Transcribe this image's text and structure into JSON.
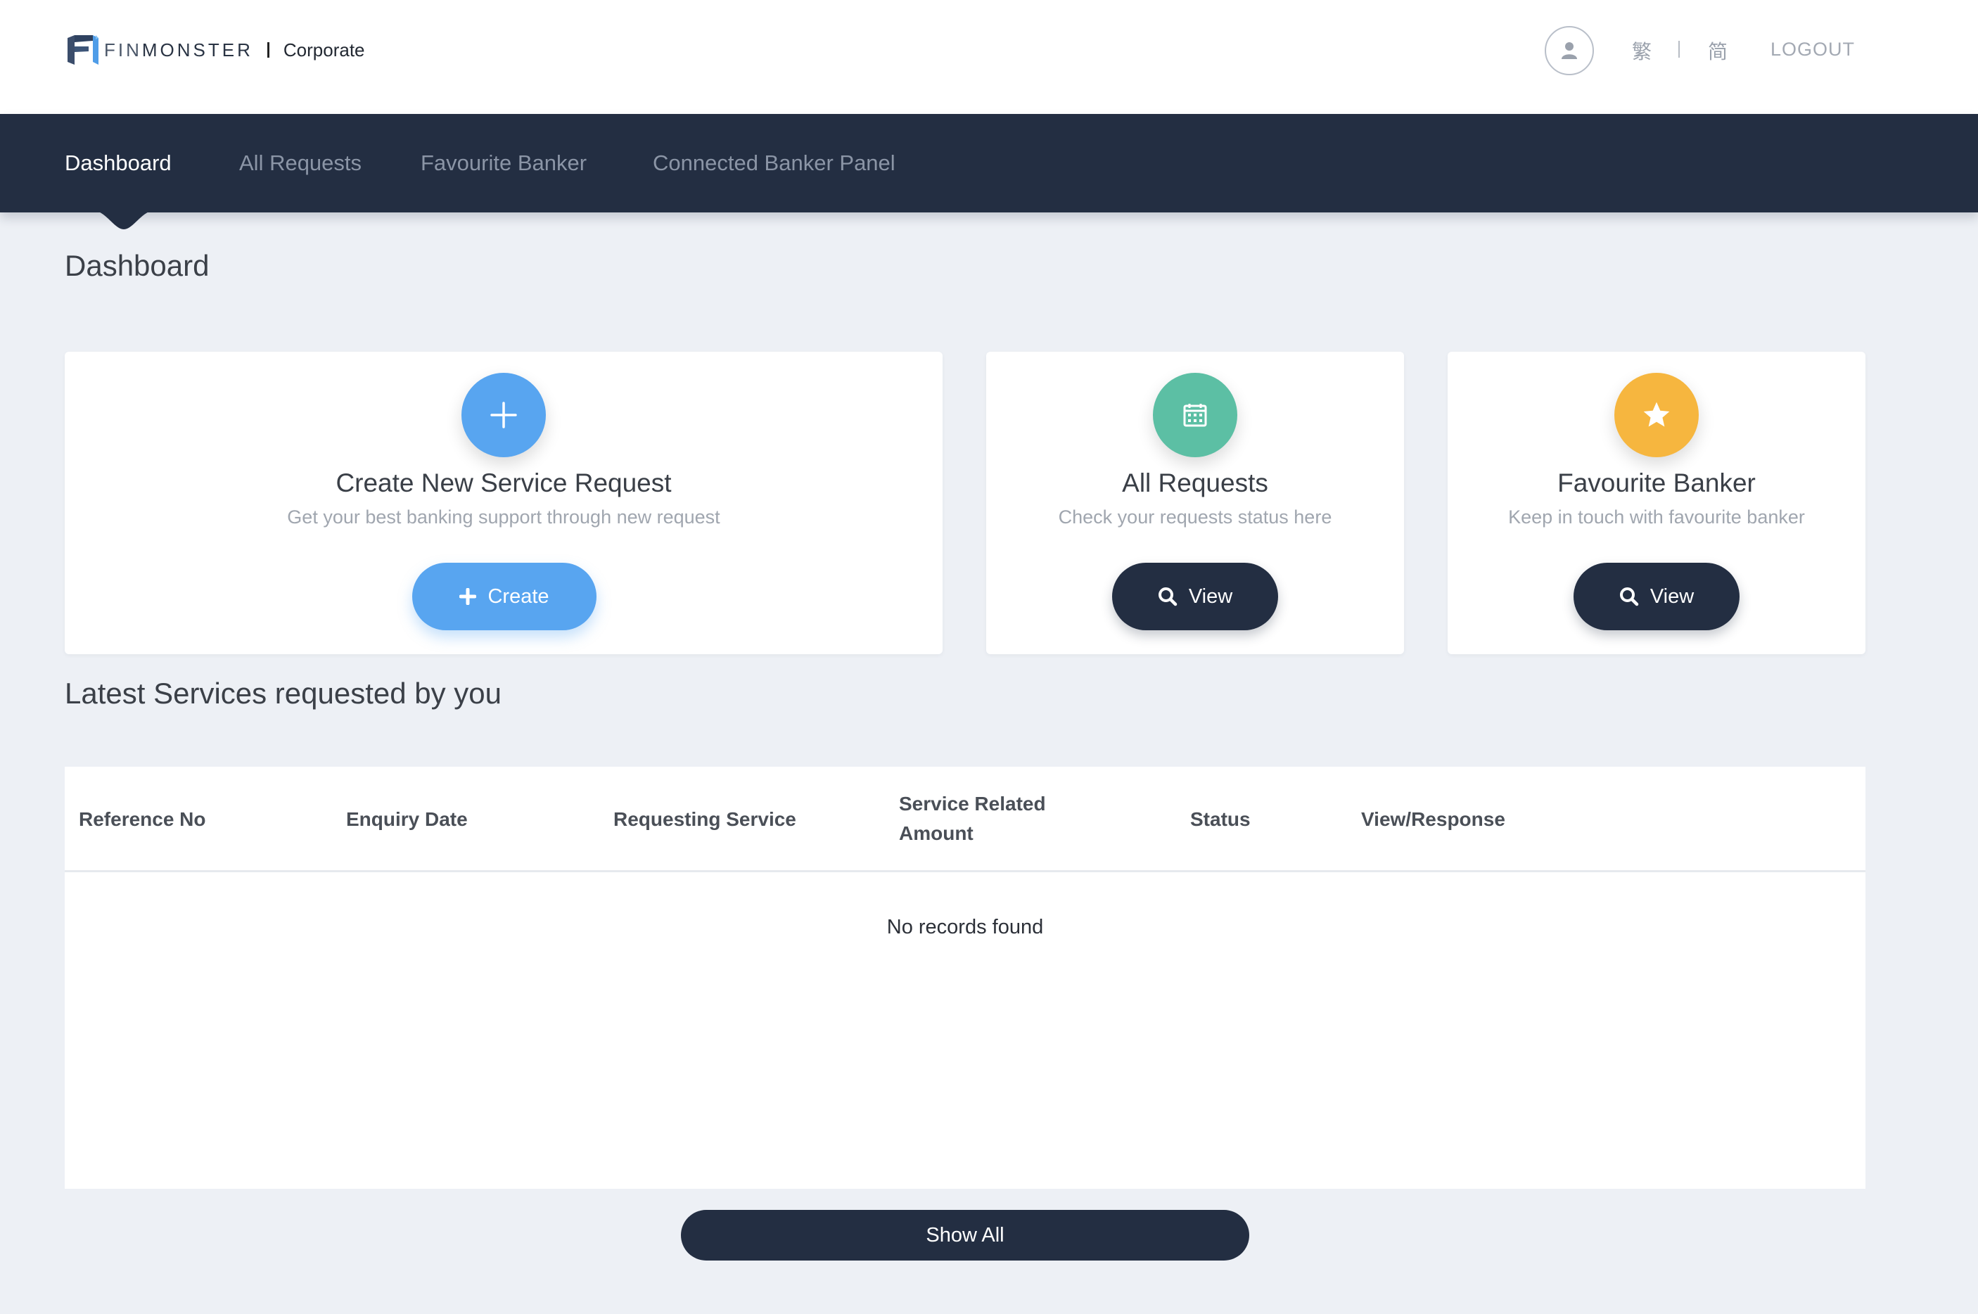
{
  "header": {
    "logo_text_prefix": "FIN",
    "logo_text_suffix": "MONSTER",
    "logo_sub": "Corporate",
    "lang_traditional": "繁",
    "lang_simplified": "简",
    "logout_label": "LOGOUT"
  },
  "nav": {
    "items": [
      {
        "label": "Dashboard",
        "active": true
      },
      {
        "label": "All Requests",
        "active": false
      },
      {
        "label": "Favourite Banker",
        "active": false
      },
      {
        "label": "Connected Banker Panel",
        "active": false
      }
    ]
  },
  "page": {
    "title": "Dashboard"
  },
  "cards": [
    {
      "title": "Create New Service Request",
      "desc": "Get your best banking support through new request",
      "button_label": "Create",
      "icon": "plus-icon",
      "color": "#58a5f0"
    },
    {
      "title": "All Requests",
      "desc": "Check your requests status here",
      "button_label": "View",
      "icon": "calendar-icon",
      "color": "#5cbfa4"
    },
    {
      "title": "Favourite Banker",
      "desc": "Keep in touch with favourite banker",
      "button_label": "View",
      "icon": "star-icon",
      "color": "#f6b63f"
    }
  ],
  "latest": {
    "title": "Latest Services requested by you",
    "columns": [
      "Reference No",
      "Enquiry Date",
      "Requesting Service",
      "Service Related Amount",
      "Status",
      "View/Response"
    ],
    "column_lines": [
      [
        "Reference No"
      ],
      [
        "Enquiry Date"
      ],
      [
        "Requesting Service"
      ],
      [
        "Service Related",
        "Amount"
      ],
      [
        "Status"
      ],
      [
        "View/Response"
      ]
    ],
    "rows": [],
    "empty_message": "No records found",
    "show_all_label": "Show All"
  },
  "colors": {
    "nav_bg": "#232e42",
    "accent_blue": "#58a5f0",
    "accent_green": "#5cbfa4",
    "accent_yellow": "#f6b63f",
    "page_bg": "#edf0f5"
  }
}
